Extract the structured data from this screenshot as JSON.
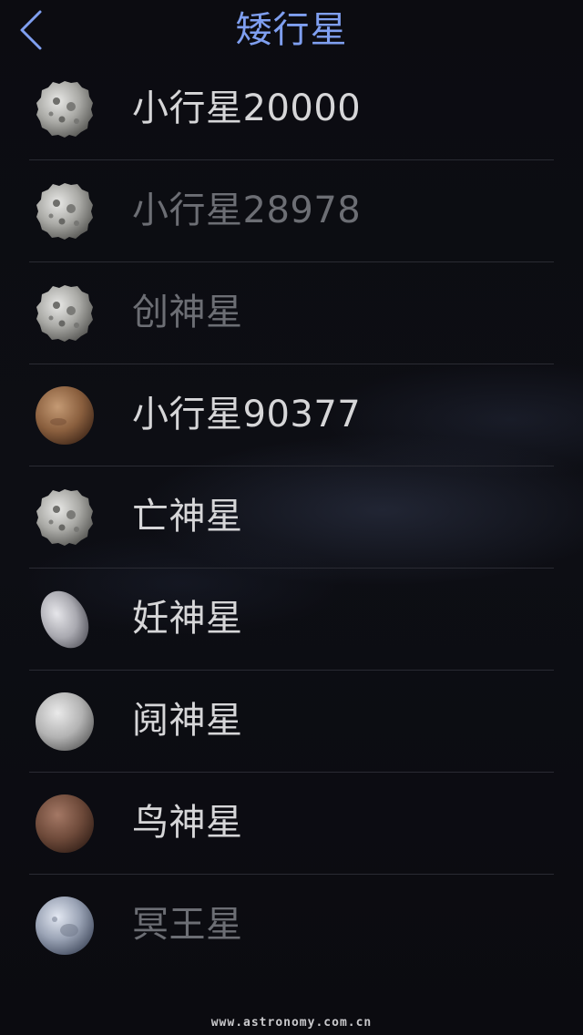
{
  "colors": {
    "accent": "#7f9ff0",
    "text_active": "#d6d6d8",
    "text_dim": "#6c6e74",
    "divider": "#2a2b33",
    "footer": "#c9c9cc"
  },
  "header": {
    "back_icon": "chevron-left-icon",
    "title": "矮行星"
  },
  "items": [
    {
      "label": "小行星20000",
      "icon": "asteroid-icon",
      "state": "active"
    },
    {
      "label": "小行星28978",
      "icon": "asteroid-icon",
      "state": "dim"
    },
    {
      "label": "创神星",
      "icon": "asteroid-icon",
      "state": "dim"
    },
    {
      "label": "小行星90377",
      "icon": "brown-planet-icon",
      "state": "active"
    },
    {
      "label": "亡神星",
      "icon": "asteroid-icon",
      "state": "active"
    },
    {
      "label": "妊神星",
      "icon": "ellipsoid-planet-icon",
      "state": "active"
    },
    {
      "label": "阋神星",
      "icon": "grey-planet-icon",
      "state": "active"
    },
    {
      "label": "鸟神星",
      "icon": "brown-planet-icon",
      "state": "active"
    },
    {
      "label": "冥王星",
      "icon": "pluto-icon",
      "state": "dim"
    }
  ],
  "footer": {
    "watermark": "www.astronomy.com.cn"
  }
}
